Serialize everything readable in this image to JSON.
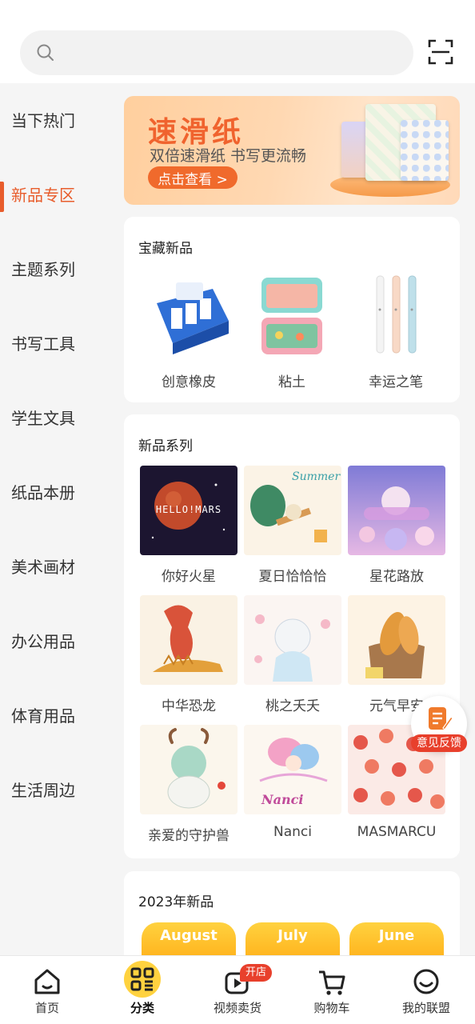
{
  "search": {
    "placeholder": ""
  },
  "sidebar": {
    "items": [
      {
        "label": "当下热门"
      },
      {
        "label": "新品专区"
      },
      {
        "label": "主题系列"
      },
      {
        "label": "书写工具"
      },
      {
        "label": "学生文具"
      },
      {
        "label": "纸品本册"
      },
      {
        "label": "美术画材"
      },
      {
        "label": "办公用品"
      },
      {
        "label": "体育用品"
      },
      {
        "label": "生活周边"
      }
    ],
    "active_index": 1
  },
  "banner": {
    "title": "速滑纸",
    "subtitle": "双倍速滑纸 书写更流畅",
    "button": "点击查看 >"
  },
  "treasure": {
    "title": "宝藏新品",
    "items": [
      {
        "label": "创意橡皮"
      },
      {
        "label": "粘土"
      },
      {
        "label": "幸运之笔"
      }
    ]
  },
  "series": {
    "title": "新品系列",
    "items": [
      {
        "label": "你好火星"
      },
      {
        "label": "夏日恰恰恰"
      },
      {
        "label": "星花路放"
      },
      {
        "label": "中华恐龙"
      },
      {
        "label": "桃之夭夭"
      },
      {
        "label": "元气早安"
      },
      {
        "label": "亲爱的守护兽"
      },
      {
        "label": "Nanci"
      },
      {
        "label": "MASMARCU"
      }
    ],
    "thumb_text": {
      "mars": "HELLO!MARS",
      "summer": "Summer",
      "nanci": "Nanci"
    }
  },
  "new2023": {
    "title": "2023年新品",
    "tabs": [
      "August",
      "July",
      "June"
    ]
  },
  "feedback": {
    "label": "意见反馈"
  },
  "bottom_nav": {
    "items": [
      {
        "label": "首页"
      },
      {
        "label": "分类"
      },
      {
        "label": "视频卖货"
      },
      {
        "label": "购物车"
      },
      {
        "label": "我的联盟"
      }
    ],
    "badge": "开店",
    "active_index": 1
  },
  "colors": {
    "accent": "#e85d2c",
    "badge": "#e8402c",
    "tab_gold": "#ffb41e"
  },
  "icons": {
    "search": "search-icon",
    "scan": "scan-icon",
    "home": "home-icon",
    "category": "category-icon",
    "video": "video-icon",
    "cart": "cart-icon",
    "profile": "smile-icon",
    "feedback": "edit-note-icon"
  }
}
